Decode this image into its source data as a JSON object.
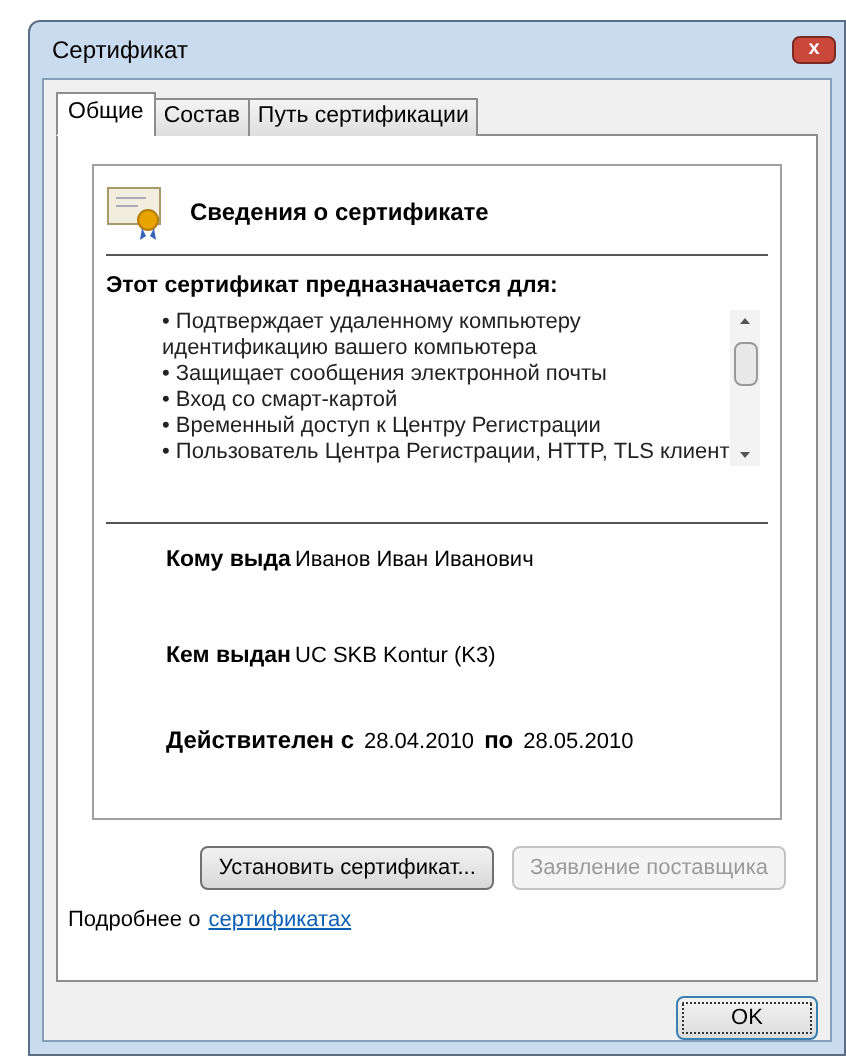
{
  "window": {
    "title": "Сертификат",
    "close": "x"
  },
  "tabs": [
    {
      "label": "Общие",
      "selected": true
    },
    {
      "label": "Состав",
      "selected": false
    },
    {
      "label": "Путь сертификации",
      "selected": false
    }
  ],
  "info": {
    "title": "Сведения о сертификате",
    "purpose_heading": "Этот сертификат предназначается для:",
    "purposes": [
      "• Подтверждает удаленному компьютеру идентификацию вашего компьютера",
      "• Защищает сообщения электронной почты",
      "• Вход со смарт-картой",
      "• Временный доступ к Центру Регистрации",
      "• Пользователь Центра Регистрации, HTTP, TLS клиент"
    ],
    "issued_to": {
      "label": "Кому выда",
      "value": "Иванов Иван Иванович"
    },
    "issued_by": {
      "label": "Кем выдан",
      "value": "UC SKB Kontur (K3)"
    },
    "validity": {
      "label": "Действителен с",
      "from": "28.04.2010",
      "to_label": "по",
      "to": "28.05.2010"
    }
  },
  "buttons": [
    {
      "label": "Установить сертификат...",
      "disabled": false
    },
    {
      "label": "Заявление поставщика",
      "disabled": true
    }
  ],
  "more": {
    "text": "Подробнее о",
    "link": "сертификатах"
  },
  "ok_button": "OK"
}
